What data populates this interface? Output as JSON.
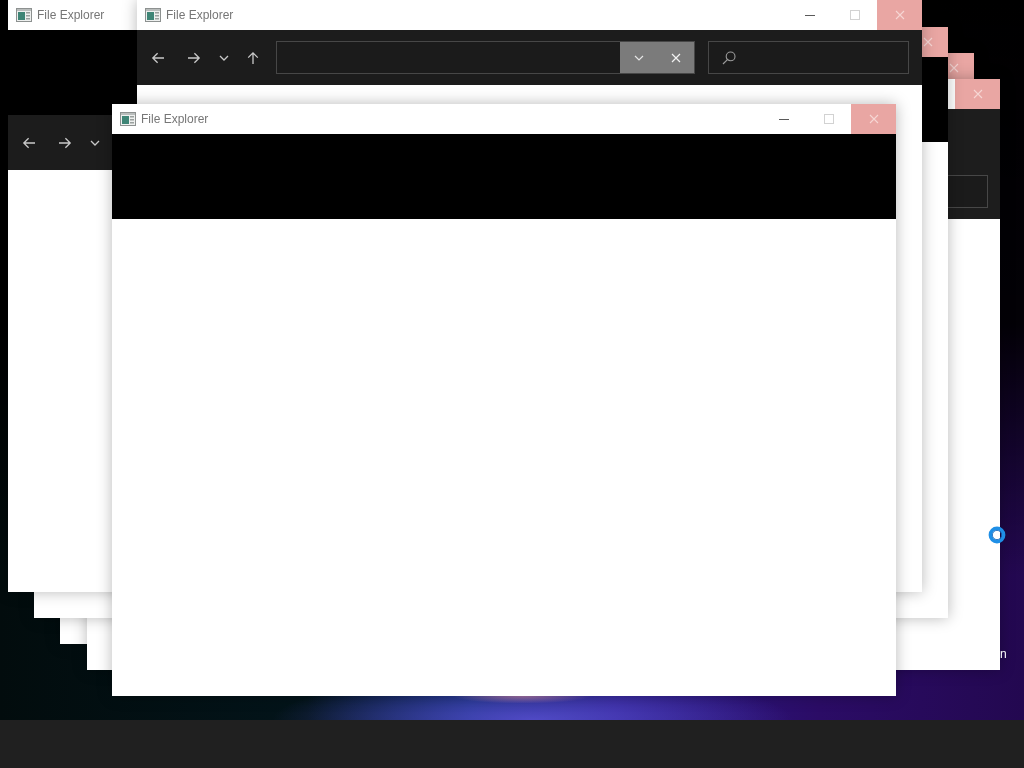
{
  "desktop": {
    "icon_label": "n"
  },
  "windows": [
    {
      "kind": "frame"
    },
    {
      "kind": "explorer"
    },
    {
      "kind": "blank"
    },
    {
      "kind": "banded",
      "title": "File Explorer"
    },
    {
      "kind": "explorer",
      "title": "File Explorer"
    },
    {
      "kind": "blank",
      "title": "File Explorer"
    }
  ]
}
